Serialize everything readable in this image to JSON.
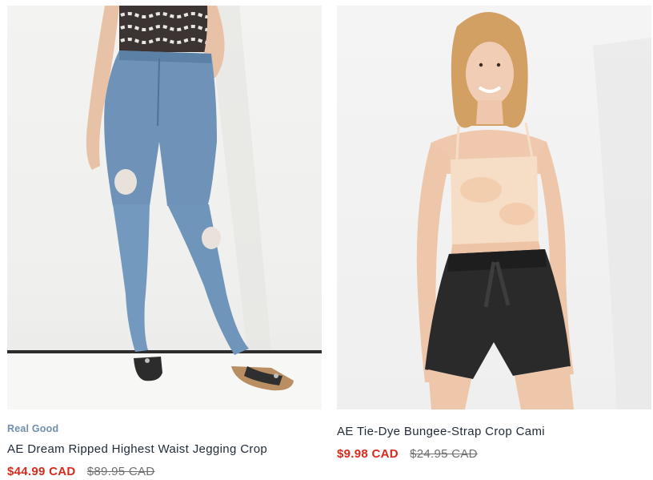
{
  "products": [
    {
      "badge": "Real Good",
      "name": "AE Dream Ripped Highest Waist Jegging Crop",
      "sale_price": "$44.99 CAD",
      "original_price": "$89.95 CAD",
      "image_name": "jeans-product-photo"
    },
    {
      "name": "AE Tie-Dye Bungee-Strap Crop Cami",
      "sale_price": "$9.98 CAD",
      "original_price": "$24.95 CAD",
      "image_name": "cami-product-photo"
    }
  ],
  "colors": {
    "badge": "#6f8fad",
    "title": "#1f2a36",
    "sale": "#d52b1e",
    "original": "#6f6f6f"
  }
}
